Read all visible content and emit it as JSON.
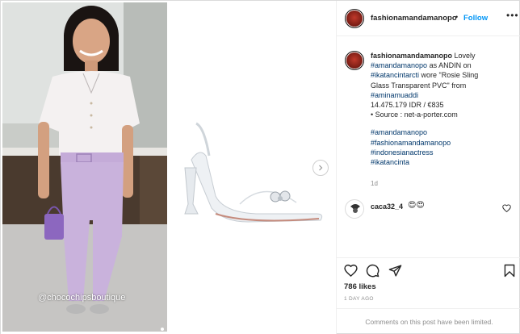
{
  "media": {
    "watermark": "@chocochipsboutique",
    "next_icon": "chevron-right-icon"
  },
  "header": {
    "username": "fashionamandamanopo",
    "separator": "•",
    "follow_label": "Follow",
    "more_icon": "more-options-icon",
    "more_label": "•••"
  },
  "caption": {
    "username": "fashionamandamanopo",
    "lines": {
      "l1_text": "Lovely",
      "l2_tag": "#amandamanopo",
      "l2_text": " as ANDIN on",
      "l3_tag": "#ikatancintarcti",
      "l3_text": " wore \"Rosie Sling",
      "l4_text": "Glass Transparent PVC\" from",
      "l5_tag": "#aminamuaddi",
      "l6_text": "14.475.179 IDR / €835",
      "l7_text": "• Source : net-a-porter.com",
      "h1": "#amandamanopo",
      "h2": "#fashionamandamanopo",
      "h3": "#indonesianactress",
      "h4": "#ikatancinta"
    },
    "time": "1d"
  },
  "comment": {
    "username": "caca32_4",
    "emoji": "😍😍"
  },
  "actions": {
    "like_icon": "heart-icon",
    "comment_icon": "comment-icon",
    "share_icon": "share-icon",
    "save_icon": "bookmark-icon"
  },
  "likes": "786 likes",
  "posted": "1 DAY AGO",
  "limited": "Comments on this post have been limited.",
  "colors": {
    "link": "#00376b",
    "follow": "#0095f6",
    "muted": "#8e8e8e",
    "blouse": "#f4f1f1",
    "trousers": "#c9b2dc"
  }
}
